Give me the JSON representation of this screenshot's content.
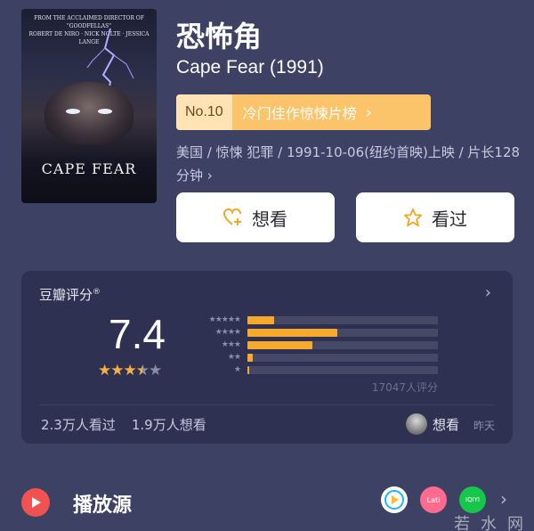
{
  "poster": {
    "credits_line1": "FROM THE ACCLAIMED DIRECTOR OF \"GOODFELLAS\"",
    "credits_line2": "ROBERT DE NIRO · NICK NOLTE · JESSICA LANGE",
    "title": "CAPE FEAR"
  },
  "movie": {
    "title_cn": "恐怖角",
    "title_en": "Cape Fear (1991)",
    "rank_no": "No.10",
    "rank_name": "冷门佳作惊悚片榜",
    "meta": "美国 / 惊悚 犯罪 / 1991-10-06(纽约首映)上映 / 片长128 分钟 ›"
  },
  "actions": {
    "want_label": "想看",
    "seen_label": "看过"
  },
  "rating": {
    "label": "豆瓣评分",
    "score": "7.4",
    "stars_value": 3.5,
    "distribution": [
      {
        "stars": "★★★★★",
        "fraction": 0.14
      },
      {
        "stars": "★★★★",
        "fraction": 0.47
      },
      {
        "stars": "★★★",
        "fraction": 0.34
      },
      {
        "stars": "★★",
        "fraction": 0.03
      },
      {
        "stars": "★",
        "fraction": 0.01
      }
    ],
    "count": "17047人评分",
    "watched": "2.3万人看过",
    "wanted": "1.9万人想看",
    "friend_action": "想看",
    "friend_time": "昨天"
  },
  "play": {
    "label": "播放源",
    "source_2": "Lati",
    "source_3": "IQIYI"
  },
  "watermark": "若水网",
  "colors": {
    "background": "#3d4163",
    "card": "#2e3151",
    "accent": "#f7a92c",
    "rank_bg": "#fbc36a",
    "play_red": "#f0524f"
  }
}
